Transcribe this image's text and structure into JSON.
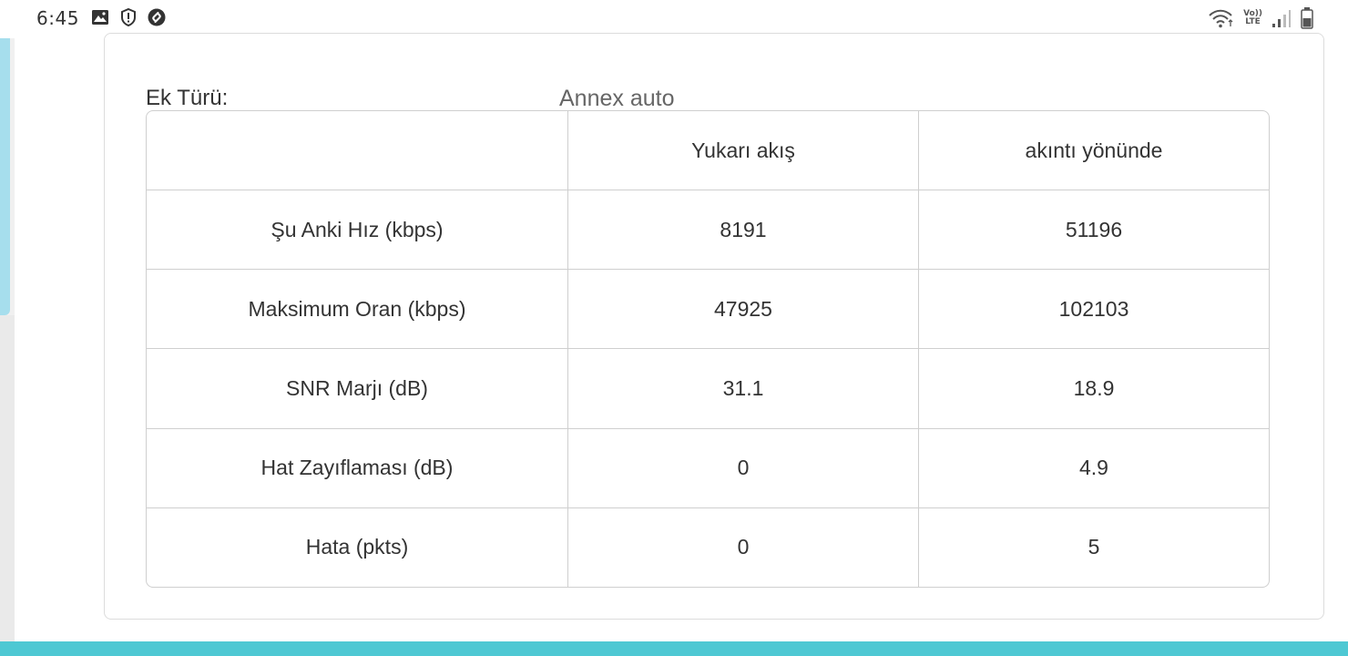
{
  "status_bar": {
    "time": "6:45",
    "left_icons": [
      "image-icon",
      "alert-shield-icon",
      "shazam-icon"
    ],
    "right_icons": [
      "wifi-icon",
      "volte-lte-icon",
      "signal-icon",
      "battery-icon"
    ],
    "volte_top": "Vo))",
    "volte_bottom": "LTE"
  },
  "card": {
    "annex_label": "Ek Türü:",
    "annex_value": "Annex auto"
  },
  "table": {
    "headers": [
      "",
      "Yukarı akış",
      "akıntı yönünde"
    ],
    "rows": [
      [
        "Şu Anki Hız (kbps)",
        "8191",
        "51196"
      ],
      [
        "Maksimum Oran (kbps)",
        "47925",
        "102103"
      ],
      [
        "SNR Marjı (dB)",
        "31.1",
        "18.9"
      ],
      [
        "Hat Zayıflaması (dB)",
        "0",
        "4.9"
      ],
      [
        "Hata (pkts)",
        "0",
        "5"
      ]
    ]
  },
  "colors": {
    "accent_bottom": "#4ec8d3",
    "scroll_indicator": "#a6deed"
  }
}
